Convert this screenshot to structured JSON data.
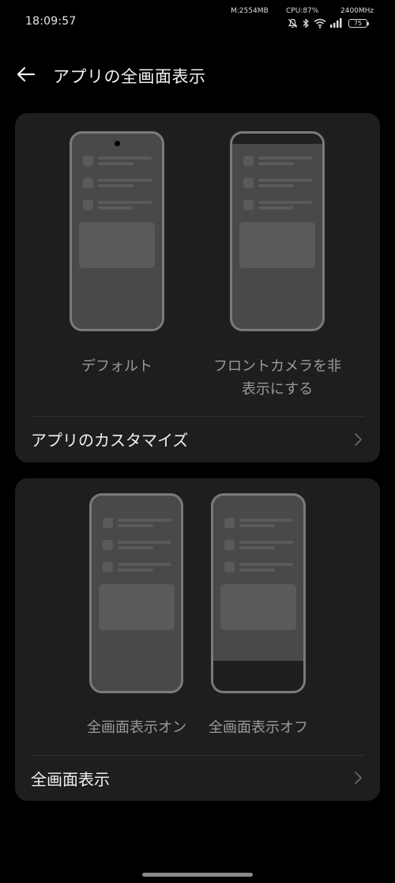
{
  "status_bar": {
    "time": "18:09:57",
    "memory": "M:2554MB",
    "cpu": "CPU:87%",
    "frequency": "2400MHz",
    "battery": "75",
    "icons": [
      "mute-icon",
      "bluetooth-icon",
      "wifi-icon",
      "signal-icon",
      "battery-icon"
    ]
  },
  "header": {
    "back_icon": "back-arrow-icon",
    "title": "アプリの全画面表示"
  },
  "card_camera": {
    "option_default": "デフォルト",
    "option_hide_camera_line1": "フロントカメラを非",
    "option_hide_camera_line2": "表示にする",
    "row_label": "アプリのカスタマイズ",
    "row_icon": "chevron-right-icon"
  },
  "card_fullscreen": {
    "option_on": "全画面表示オン",
    "option_off": "全画面表示オフ",
    "row_label": "全画面表示",
    "row_icon": "chevron-right-icon"
  },
  "colors": {
    "background": "#000000",
    "card": "#1e1e1e",
    "phone_frame": "#7a7a7c",
    "caption_text": "#9a9a9a"
  }
}
